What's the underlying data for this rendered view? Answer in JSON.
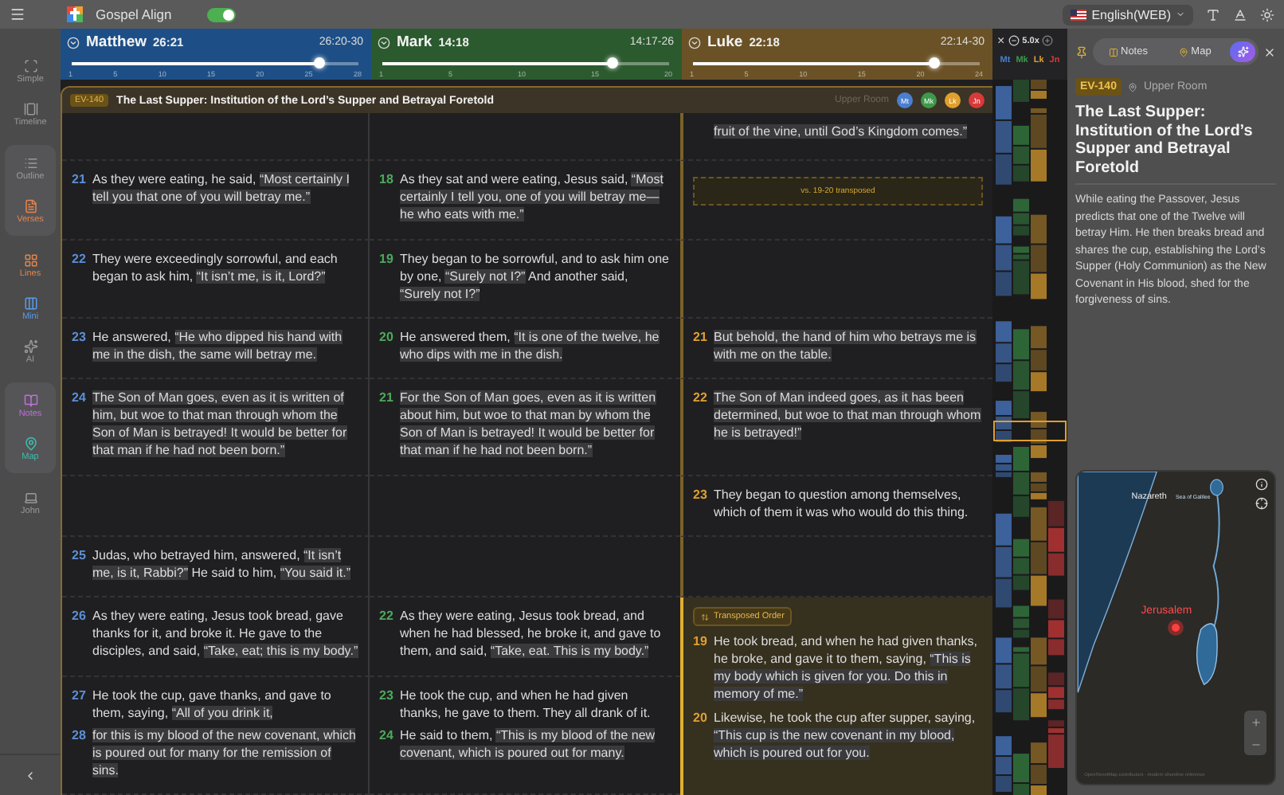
{
  "topbar": {
    "app_name": "Gospel Align",
    "toggle_on": true,
    "language": "English(WEB)"
  },
  "sidebar": {
    "sections": [
      {
        "boxed": false,
        "items": [
          {
            "label": "Simple",
            "color": "#9a9a9a"
          },
          {
            "label": "Timeline",
            "color": "#9a9a9a"
          }
        ]
      },
      {
        "boxed": true,
        "items": [
          {
            "label": "Outline",
            "color": "#9a9a9a"
          },
          {
            "label": "Verses",
            "color": "#e8844a"
          }
        ]
      },
      {
        "boxed": false,
        "items": [
          {
            "label": "Lines",
            "color": "#e8844a"
          },
          {
            "label": "Mini",
            "color": "#5b9be8"
          },
          {
            "label": "AI",
            "color": "#9a9a9a"
          }
        ]
      },
      {
        "boxed": true,
        "items": [
          {
            "label": "Notes",
            "color": "#c070d8"
          },
          {
            "label": "Map",
            "color": "#3cc0b0"
          }
        ]
      },
      {
        "boxed": false,
        "items": [
          {
            "label": "John",
            "color": "#9a9a9a"
          }
        ]
      }
    ]
  },
  "gospels": [
    {
      "name": "Matthew",
      "ref": "26:21",
      "range": "26:20-30",
      "color": "#1d4f86",
      "level": 0.86,
      "ticks": [
        "1",
        "5",
        "10",
        "15",
        "20",
        "25",
        "28"
      ]
    },
    {
      "name": "Mark",
      "ref": "14:18",
      "range": "14:17-26",
      "color": "#2b5a2e",
      "level": 0.8,
      "ticks": [
        "1",
        "5",
        "10",
        "15",
        "20"
      ]
    },
    {
      "name": "Luke",
      "ref": "22:18",
      "range": "22:14-30",
      "color": "#6b5226",
      "level": 0.84,
      "ticks": [
        "1",
        "5",
        "10",
        "15",
        "20",
        "24"
      ]
    }
  ],
  "mini": {
    "close": "×",
    "zoom": "5.0x",
    "tags": [
      {
        "abbr": "Mt",
        "color": "#4a7fd0"
      },
      {
        "abbr": "Mk",
        "color": "#3d9a4a"
      },
      {
        "abbr": "Lk",
        "color": "#e0a030"
      },
      {
        "abbr": "Jn",
        "color": "#d83a3a"
      }
    ]
  },
  "section": {
    "badge": "EV-140",
    "title": "The Last Supper: Institution of the Lord’s Supper and Betrayal Foretold",
    "location": "Upper Room",
    "gospels": [
      {
        "abbr": "Mt",
        "color": "#4a7fd0"
      },
      {
        "abbr": "Mk",
        "color": "#3d9a4a"
      },
      {
        "abbr": "Lk",
        "color": "#e0a030"
      },
      {
        "abbr": "Jn",
        "color": "#d83a3a"
      }
    ]
  },
  "rows": [
    {
      "cells": [
        {
          "kind": "empty"
        },
        {
          "kind": "empty"
        },
        {
          "kind": "verses",
          "verses": [
            {
              "parts": [
                {
                  "text": "fruit of the vine, until God’s Kingdom comes.”",
                  "highlighted": true
                }
              ]
            }
          ]
        }
      ]
    },
    {
      "cells": [
        {
          "kind": "verses",
          "verses": [
            {
              "num": "21",
              "parts": [
                {
                  "text": "As they were eating, he said, ",
                  "highlighted": false
                },
                {
                  "text": "“Most certainly I tell you that one of you will betray me.”",
                  "highlighted": true
                }
              ]
            }
          ]
        },
        {
          "kind": "verses",
          "verses": [
            {
              "num": "18",
              "parts": [
                {
                  "text": "As they sat and were eating, Jesus said, ",
                  "highlighted": false
                },
                {
                  "text": "“Most certainly I tell you, one of you will betray me—he who eats with me.”",
                  "highlighted": true
                }
              ]
            }
          ]
        },
        {
          "kind": "note",
          "text": "vs. 19-20 transposed"
        }
      ]
    },
    {
      "cells": [
        {
          "kind": "verses",
          "verses": [
            {
              "num": "22",
              "parts": [
                {
                  "text": "They were exceedingly sorrowful, and each began to ask him, ",
                  "highlighted": false
                },
                {
                  "text": "“It isn’t me, is it, Lord?”",
                  "highlighted": true
                }
              ]
            }
          ]
        },
        {
          "kind": "verses",
          "verses": [
            {
              "num": "19",
              "parts": [
                {
                  "text": "They began to be sorrowful, and to ask him one by one, ",
                  "highlighted": false
                },
                {
                  "text": "“Surely not I?”",
                  "highlighted": true
                },
                {
                  "text": " And another said, ",
                  "highlighted": false
                },
                {
                  "text": "“Surely not I?”",
                  "highlighted": true
                }
              ]
            }
          ]
        },
        {
          "kind": "empty"
        }
      ]
    },
    {
      "cells": [
        {
          "kind": "verses",
          "verses": [
            {
              "num": "23",
              "parts": [
                {
                  "text": "He answered, ",
                  "highlighted": false
                },
                {
                  "text": "“He who dipped his hand with me in the dish, the same will betray me.",
                  "highlighted": true
                }
              ]
            }
          ]
        },
        {
          "kind": "verses",
          "verses": [
            {
              "num": "20",
              "parts": [
                {
                  "text": "He answered them, ",
                  "highlighted": false
                },
                {
                  "text": "“It is one of the twelve, he who dips with me in the dish.",
                  "highlighted": true
                }
              ]
            }
          ]
        },
        {
          "kind": "verses",
          "verses": [
            {
              "num": "21",
              "parts": [
                {
                  "text": "But behold, the hand of him who betrays me is with me on the table.",
                  "highlighted": true
                }
              ]
            }
          ]
        }
      ]
    },
    {
      "cells": [
        {
          "kind": "verses",
          "verses": [
            {
              "num": "24",
              "parts": [
                {
                  "text": "The Son of Man goes, even as it is written of him, but woe to that man through whom the Son of Man is betrayed! It would be better for that man if he had not been born.”",
                  "highlighted": true
                }
              ]
            }
          ]
        },
        {
          "kind": "verses",
          "verses": [
            {
              "num": "21",
              "parts": [
                {
                  "text": "For the Son of Man goes, even as it is written about him, but woe to that man by whom the Son of Man is betrayed! It would be better for that man if he had not been born.”",
                  "highlighted": true
                }
              ]
            }
          ]
        },
        {
          "kind": "verses",
          "verses": [
            {
              "num": "22",
              "parts": [
                {
                  "text": "The Son of Man indeed goes, as it has been determined, but woe to that man through whom he is betrayed!”",
                  "highlighted": true
                }
              ]
            }
          ]
        }
      ]
    },
    {
      "cells": [
        {
          "kind": "empty"
        },
        {
          "kind": "empty"
        },
        {
          "kind": "verses",
          "verses": [
            {
              "num": "23",
              "parts": [
                {
                  "text": "They began to question among themselves, which of them it was who would do this thing.",
                  "highlighted": false
                }
              ]
            }
          ]
        }
      ]
    },
    {
      "cells": [
        {
          "kind": "verses",
          "verses": [
            {
              "num": "25",
              "parts": [
                {
                  "text": "Judas, who betrayed him, answered, ",
                  "highlighted": false
                },
                {
                  "text": "“It isn’t me, is it, Rabbi?”",
                  "highlighted": true
                },
                {
                  "text": " He said to him, ",
                  "highlighted": false
                },
                {
                  "text": "“You said it.”",
                  "highlighted": true
                }
              ]
            }
          ]
        },
        {
          "kind": "empty"
        },
        {
          "kind": "empty"
        }
      ]
    },
    {
      "cells": [
        {
          "kind": "verses",
          "verses": [
            {
              "num": "26",
              "parts": [
                {
                  "text": "As they were eating, Jesus took bread, gave thanks for it, and broke it. He gave to the disciples, and said, ",
                  "highlighted": false
                },
                {
                  "text": "“Take, eat; this is my body.”",
                  "highlighted": true
                }
              ]
            }
          ]
        },
        {
          "kind": "verses",
          "verses": [
            {
              "num": "22",
              "parts": [
                {
                  "text": "As they were eating, Jesus took bread, and when he had blessed, he broke it, and gave to them, and said, ",
                  "highlighted": false
                },
                {
                  "text": "“Take, eat. This is my body.”",
                  "highlighted": true
                }
              ]
            }
          ]
        },
        {
          "kind": "transposed",
          "label": "Transposed Order",
          "verses": [
            {
              "num": "19",
              "parts": [
                {
                  "text": "He took bread, and when he had given thanks, he broke, and gave it to them, saying, ",
                  "highlighted": false
                },
                {
                  "text": "“This is my body which is given for you. Do this in memory of me.”",
                  "highlighted": true
                }
              ]
            },
            {
              "num": "20",
              "parts": [
                {
                  "text": "Likewise, he took the cup after supper, saying, ",
                  "highlighted": false
                },
                {
                  "text": "“This cup is the new covenant in my blood, which is poured out for you.",
                  "highlighted": true
                }
              ]
            }
          ]
        }
      ]
    },
    {
      "cells": [
        {
          "kind": "verses",
          "verses": [
            {
              "num": "27",
              "parts": [
                {
                  "text": "He took the cup, gave thanks, and gave to them, saying, ",
                  "highlighted": false
                },
                {
                  "text": "“All of you drink it,",
                  "highlighted": true
                }
              ]
            },
            {
              "num": "28",
              "parts": [
                {
                  "text": "for this is my blood of the new covenant, which is poured out for many for the remission of sins.",
                  "highlighted": true
                }
              ]
            }
          ]
        },
        {
          "kind": "verses",
          "verses": [
            {
              "num": "23",
              "parts": [
                {
                  "text": "He took the cup, and when he had given thanks, he gave to them. They all drank of it.",
                  "highlighted": false
                }
              ]
            },
            {
              "num": "24",
              "parts": [
                {
                  "text": "He said to them, ",
                  "highlighted": false
                },
                {
                  "text": "“This is my blood of the new covenant, which is poured out for many.",
                  "highlighted": true
                }
              ]
            }
          ]
        }
      ]
    }
  ],
  "panel": {
    "tabs": [
      {
        "kind": "notes",
        "label": "Notes",
        "selected": false
      },
      {
        "kind": "map",
        "label": "Map",
        "selected": false
      },
      {
        "kind": "ai",
        "selected": true
      }
    ],
    "badge": "EV-140",
    "location": "Upper Room",
    "title": "The Last Supper: Institution of the Lord’s Supper and Betrayal Foretold",
    "description": "While eating the Passover, Jesus predicts that one of the Twelve will betray Him. He then breaks bread and shares the cup, establishing the Lord’s Supper (Holy Communion) as the New Covenant in His blood, shed for the forgiveness of sins.",
    "map": {
      "places": [
        {
          "kind": "town",
          "label": "Nazareth"
        },
        {
          "kind": "lake",
          "label": "Sea of Galilee"
        },
        {
          "kind": "focus",
          "label": "Jerusalem"
        }
      ],
      "attribution": "OpenStreetMap contributors · modern shoreline reference"
    }
  }
}
